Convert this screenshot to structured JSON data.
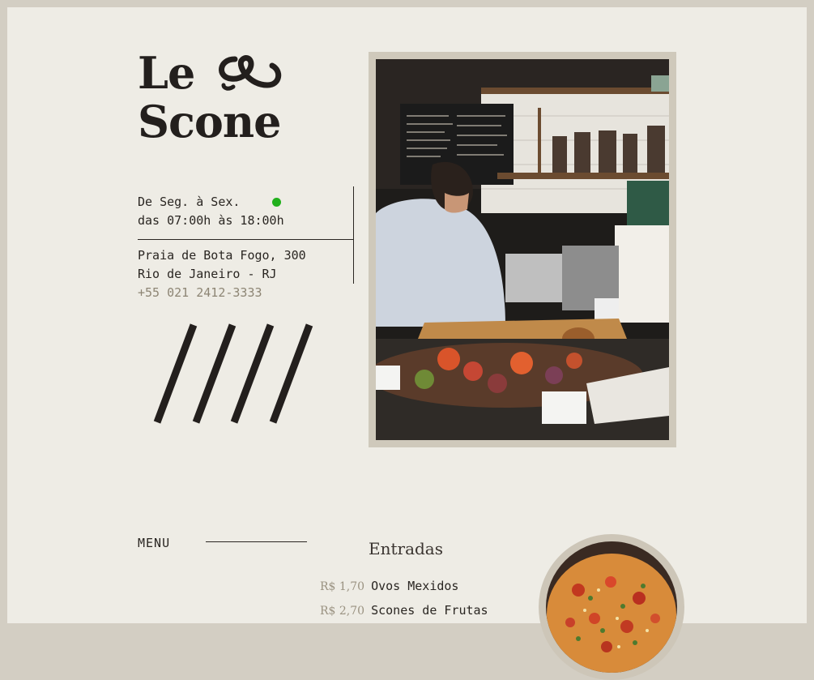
{
  "brand": {
    "line1": "Le",
    "line2": "Scone"
  },
  "hours": {
    "days": "De Seg. à Sex.",
    "time": "das 07:00h às 18:00h",
    "status_color": "#21b01c"
  },
  "contact": {
    "street": "Praia de Bota Fogo, 300",
    "city": "Rio de Janeiro - RJ",
    "phone": "+55 021 2412-3333"
  },
  "menu": {
    "label": "MENU",
    "section": "Entradas",
    "items": [
      {
        "price": "R$ 1,70",
        "name": "Ovos Mexidos"
      },
      {
        "price": "R$ 2,70",
        "name": "Scones de Frutas"
      }
    ]
  },
  "colors": {
    "background": "#eeece5",
    "frame": "#cfc9bb",
    "ink": "#2a2622"
  }
}
